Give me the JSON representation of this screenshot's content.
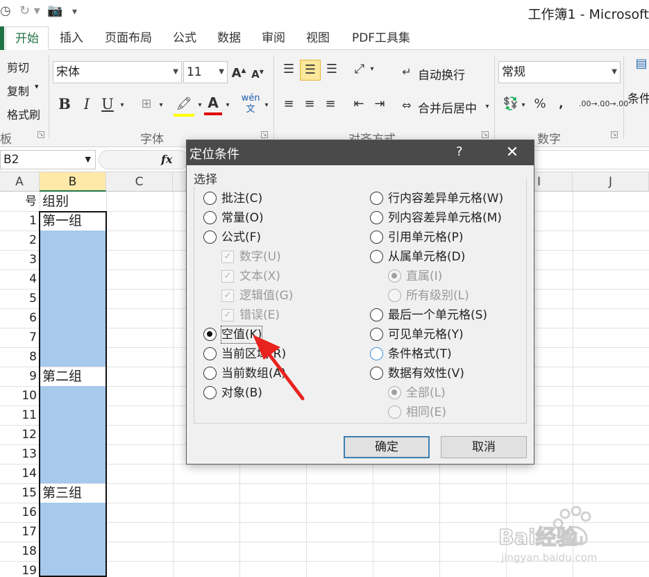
{
  "window": {
    "title": "工作簿1 - Microsoft"
  },
  "tabs": [
    {
      "label": "开始",
      "active": true
    },
    {
      "label": "插入"
    },
    {
      "label": "页面布局"
    },
    {
      "label": "公式"
    },
    {
      "label": "数据"
    },
    {
      "label": "审阅"
    },
    {
      "label": "视图"
    },
    {
      "label": "PDF工具集"
    }
  ],
  "ribbon": {
    "clipboard": {
      "cut": "剪切",
      "copy": "复制",
      "format_painter": "格式刷",
      "label": "板"
    },
    "font": {
      "name": "宋体",
      "size": "11",
      "label": "字体",
      "bold": "B",
      "italic": "I",
      "underline": "U",
      "phonetic": "wén文"
    },
    "alignment": {
      "wrap": "自动换行",
      "merge": "合并后居中",
      "label": "对齐方式"
    },
    "number": {
      "format": "常规",
      "percent": "%",
      "comma": "‚",
      "label": "数字",
      "inc_decimal": ".00→.0",
      "dec_decimal": ".0→.00"
    },
    "styles": {
      "conditional": "条件"
    }
  },
  "formula_bar": {
    "name_box": "B2",
    "fx": "fx"
  },
  "sheet": {
    "columns": [
      "A",
      "B",
      "C",
      "I",
      "J"
    ],
    "header_row": {
      "a": "号",
      "b": "组别"
    },
    "rows": [
      {
        "n": "1",
        "b": "第一组"
      },
      {
        "n": "2",
        "b": ""
      },
      {
        "n": "3",
        "b": ""
      },
      {
        "n": "4",
        "b": ""
      },
      {
        "n": "5",
        "b": ""
      },
      {
        "n": "6",
        "b": ""
      },
      {
        "n": "7",
        "b": ""
      },
      {
        "n": "8",
        "b": ""
      },
      {
        "n": "9",
        "b": "第二组"
      },
      {
        "n": "10",
        "b": ""
      },
      {
        "n": "11",
        "b": ""
      },
      {
        "n": "12",
        "b": ""
      },
      {
        "n": "13",
        "b": ""
      },
      {
        "n": "14",
        "b": ""
      },
      {
        "n": "15",
        "b": "第三组"
      },
      {
        "n": "16",
        "b": ""
      },
      {
        "n": "17",
        "b": ""
      },
      {
        "n": "18",
        "b": ""
      },
      {
        "n": "19",
        "b": ""
      }
    ],
    "colors": {
      "blank_fill": "#a6c9ec",
      "selected_header": "#ffe9a8",
      "accent": "#217346"
    }
  },
  "dialog": {
    "title": "定位条件",
    "help": "?",
    "close": "✕",
    "group_label": "选择",
    "left_options": [
      {
        "label": "批注(C)",
        "type": "radio"
      },
      {
        "label": "常量(O)",
        "type": "radio"
      },
      {
        "label": "公式(F)",
        "type": "radio"
      },
      {
        "label": "数字(U)",
        "type": "check",
        "disabled": true
      },
      {
        "label": "文本(X)",
        "type": "check",
        "disabled": true
      },
      {
        "label": "逻辑值(G)",
        "type": "check",
        "disabled": true
      },
      {
        "label": "错误(E)",
        "type": "check",
        "disabled": true
      },
      {
        "label": "空值(K)",
        "type": "radio",
        "checked": true
      },
      {
        "label": "当前区域(R)",
        "type": "radio"
      },
      {
        "label": "当前数组(A)",
        "type": "radio"
      },
      {
        "label": "对象(B)",
        "type": "radio"
      }
    ],
    "right_options": [
      {
        "label": "行内容差异单元格(W)",
        "type": "radio"
      },
      {
        "label": "列内容差异单元格(M)",
        "type": "radio"
      },
      {
        "label": "引用单元格(P)",
        "type": "radio"
      },
      {
        "label": "从属单元格(D)",
        "type": "radio"
      },
      {
        "label": "直属(I)",
        "type": "radio",
        "disabled": true,
        "checked": true
      },
      {
        "label": "所有级别(L)",
        "type": "radio",
        "disabled": true
      },
      {
        "label": "最后一个单元格(S)",
        "type": "radio"
      },
      {
        "label": "可见单元格(Y)",
        "type": "radio"
      },
      {
        "label": "条件格式(T)",
        "type": "radio",
        "hover": true
      },
      {
        "label": "数据有效性(V)",
        "type": "radio"
      },
      {
        "label": "全部(L)",
        "type": "radio",
        "disabled": true,
        "checked": true
      },
      {
        "label": "相同(E)",
        "type": "radio",
        "disabled": true
      }
    ],
    "ok": "确定",
    "cancel": "取消"
  },
  "annotation": {
    "arrow_color": "#e8231f"
  },
  "watermark": {
    "brand": "Bai经验",
    "sub": "jingyan.baidu.com",
    "logo_text": "du"
  }
}
